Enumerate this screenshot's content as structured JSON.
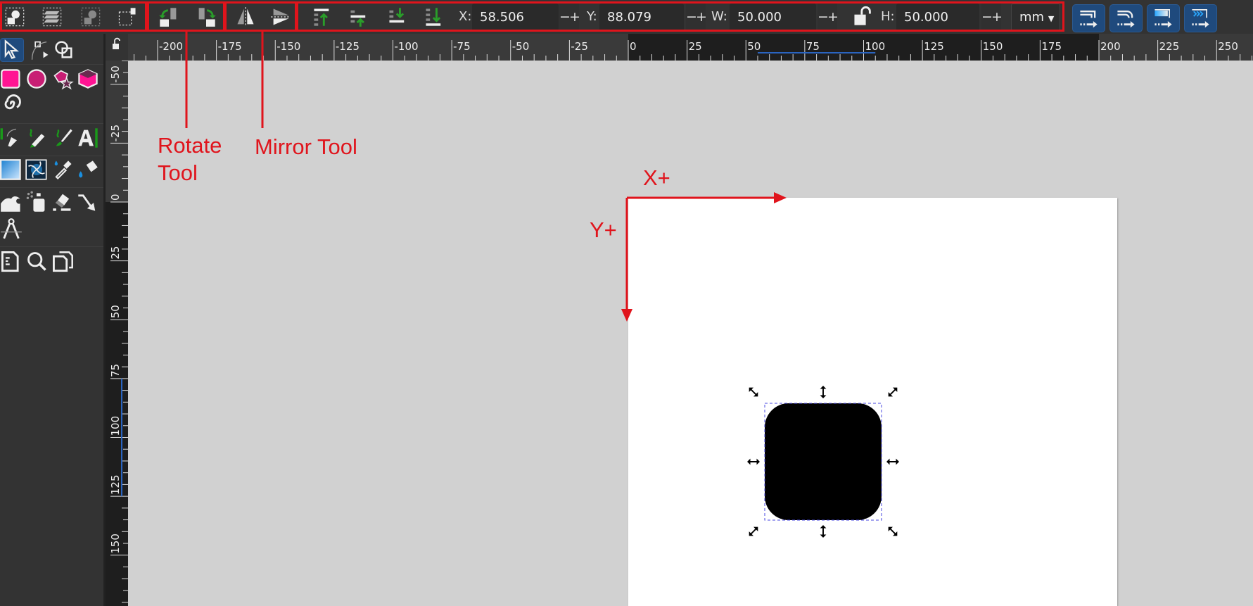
{
  "toolbar": {
    "selection_group": [
      {
        "icon": "select-all-icon"
      },
      {
        "icon": "select-all-layers-icon"
      },
      {
        "icon": "deselect-icon"
      },
      {
        "icon": "touch-select-icon"
      }
    ],
    "rotate_group": [
      {
        "icon": "rotate-ccw-icon"
      },
      {
        "icon": "rotate-cw-icon"
      }
    ],
    "mirror_group": [
      {
        "icon": "flip-horizontal-icon"
      },
      {
        "icon": "flip-vertical-icon"
      }
    ],
    "zorder_group": [
      {
        "icon": "raise-to-top-icon"
      },
      {
        "icon": "raise-icon"
      },
      {
        "icon": "lower-icon"
      },
      {
        "icon": "lower-to-bottom-icon"
      }
    ],
    "x_label": "X:",
    "x_value": "58.506",
    "y_label": "Y:",
    "y_value": "88.079",
    "w_label": "W:",
    "w_value": "50.000",
    "h_label": "H:",
    "h_value": "50.000",
    "minus": "−",
    "plus": "+",
    "lock_icon": "unlocked-icon",
    "units": "mm",
    "right_buttons": [
      {
        "icon": "scale-stroke-icon"
      },
      {
        "icon": "scale-radii-icon"
      },
      {
        "icon": "scale-gradient-icon"
      },
      {
        "icon": "scale-pattern-icon"
      }
    ]
  },
  "rulers": {
    "horizontal_labels": [
      "-200",
      "-175",
      "-150",
      "-125",
      "-100",
      "-75",
      "-50",
      "-25",
      "0",
      "25",
      "50",
      "75",
      "100",
      "125",
      "150",
      "175",
      "200",
      "225",
      "250"
    ],
    "vertical_labels": [
      "-50",
      "-25",
      "0",
      "25",
      "50",
      "75",
      "100",
      "125",
      "150"
    ],
    "selection_x_mm": [
      55,
      105
    ],
    "selection_y_mm": [
      75,
      125
    ],
    "page_width_mm": 200
  },
  "annotations": {
    "rotate_label_line1": "Rotate",
    "rotate_label_line2": "Tool",
    "mirror_label": "Mirror Tool",
    "x_axis_label": "X+",
    "y_axis_label": "Y+",
    "color": "#e0141c"
  },
  "object": {
    "x_mm": 58.506,
    "y_mm": 88.079,
    "w_mm": 50,
    "h_mm": 50,
    "fill": "#000000"
  },
  "colors": {
    "accent_blue": "#1f4a7d",
    "annotation_red": "#e0141c",
    "canvas": "#d1d1d1",
    "shape_pink": "#ff1493"
  }
}
